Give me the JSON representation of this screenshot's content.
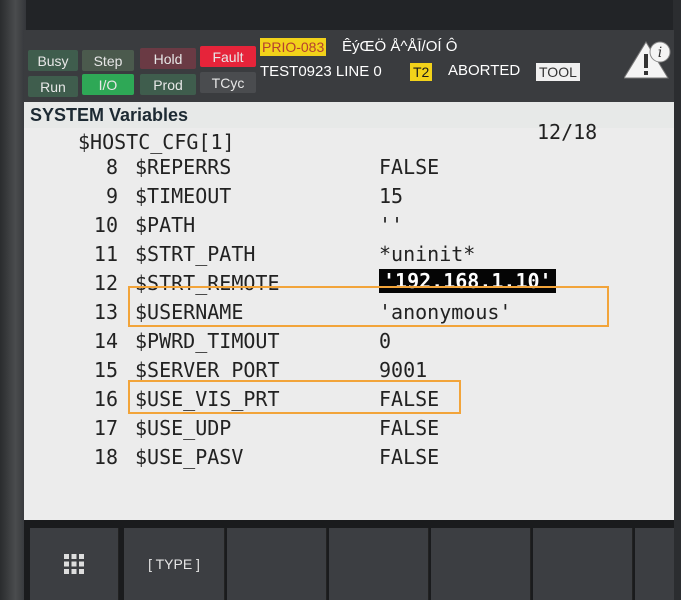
{
  "status": {
    "buttons": [
      {
        "id": "busy",
        "label": "Busy",
        "bg": "#3f5d4d"
      },
      {
        "id": "step",
        "label": "Step",
        "bg": "#4b5a4d"
      },
      {
        "id": "hold",
        "label": "Hold",
        "bg": "#6a3a44"
      },
      {
        "id": "fault",
        "label": "Fault",
        "bg": "#e6243a"
      },
      {
        "id": "run",
        "label": "Run",
        "bg": "#3f5d4d"
      },
      {
        "id": "io",
        "label": "I/O",
        "bg": "#2ea856"
      },
      {
        "id": "prod",
        "label": "Prod",
        "bg": "#3f5d4d"
      },
      {
        "id": "tcyc",
        "label": "TCyc",
        "bg": "#4a4c4f"
      }
    ],
    "prio": "PRIO-083",
    "garbled": "ÊýŒÖ Å^ÅĪ/OÍ  Ô",
    "program": "TEST0923 LINE 0",
    "t2": "T2",
    "state": "ABORTED",
    "tool": "TOOL"
  },
  "title": "SYSTEM Variables",
  "header": {
    "name": "$HOSTC_CFG[1]",
    "page": "12/18"
  },
  "rows": [
    {
      "num": "8",
      "name": "$REPERRS",
      "value": "FALSE"
    },
    {
      "num": "9",
      "name": "$TIMEOUT",
      "value": "15"
    },
    {
      "num": "10",
      "name": "$PATH",
      "value": "''"
    },
    {
      "num": "11",
      "name": "$STRT_PATH",
      "value": "*uninit*"
    },
    {
      "num": "12",
      "name": "$STRT_REMOTE",
      "value": "'192.168.1.10'"
    },
    {
      "num": "13",
      "name": "$USERNAME",
      "value": "'anonymous'"
    },
    {
      "num": "14",
      "name": "$PWRD_TIMOUT",
      "value": "0"
    },
    {
      "num": "15",
      "name": "$SERVER_PORT",
      "value": "9001"
    },
    {
      "num": "16",
      "name": "$USE_VIS_PRT",
      "value": "FALSE"
    },
    {
      "num": "17",
      "name": "$USE_UDP",
      "value": "FALSE"
    },
    {
      "num": "18",
      "name": "$USE_PASV",
      "value": "FALSE"
    }
  ],
  "fkeys": {
    "menu_icon": "grid-icon",
    "type_label": "[ TYPE ]"
  },
  "colors": {
    "highlight": "#f2a43a",
    "fault": "#e6243a",
    "io": "#2ea856",
    "prio": "#f2d21a"
  }
}
